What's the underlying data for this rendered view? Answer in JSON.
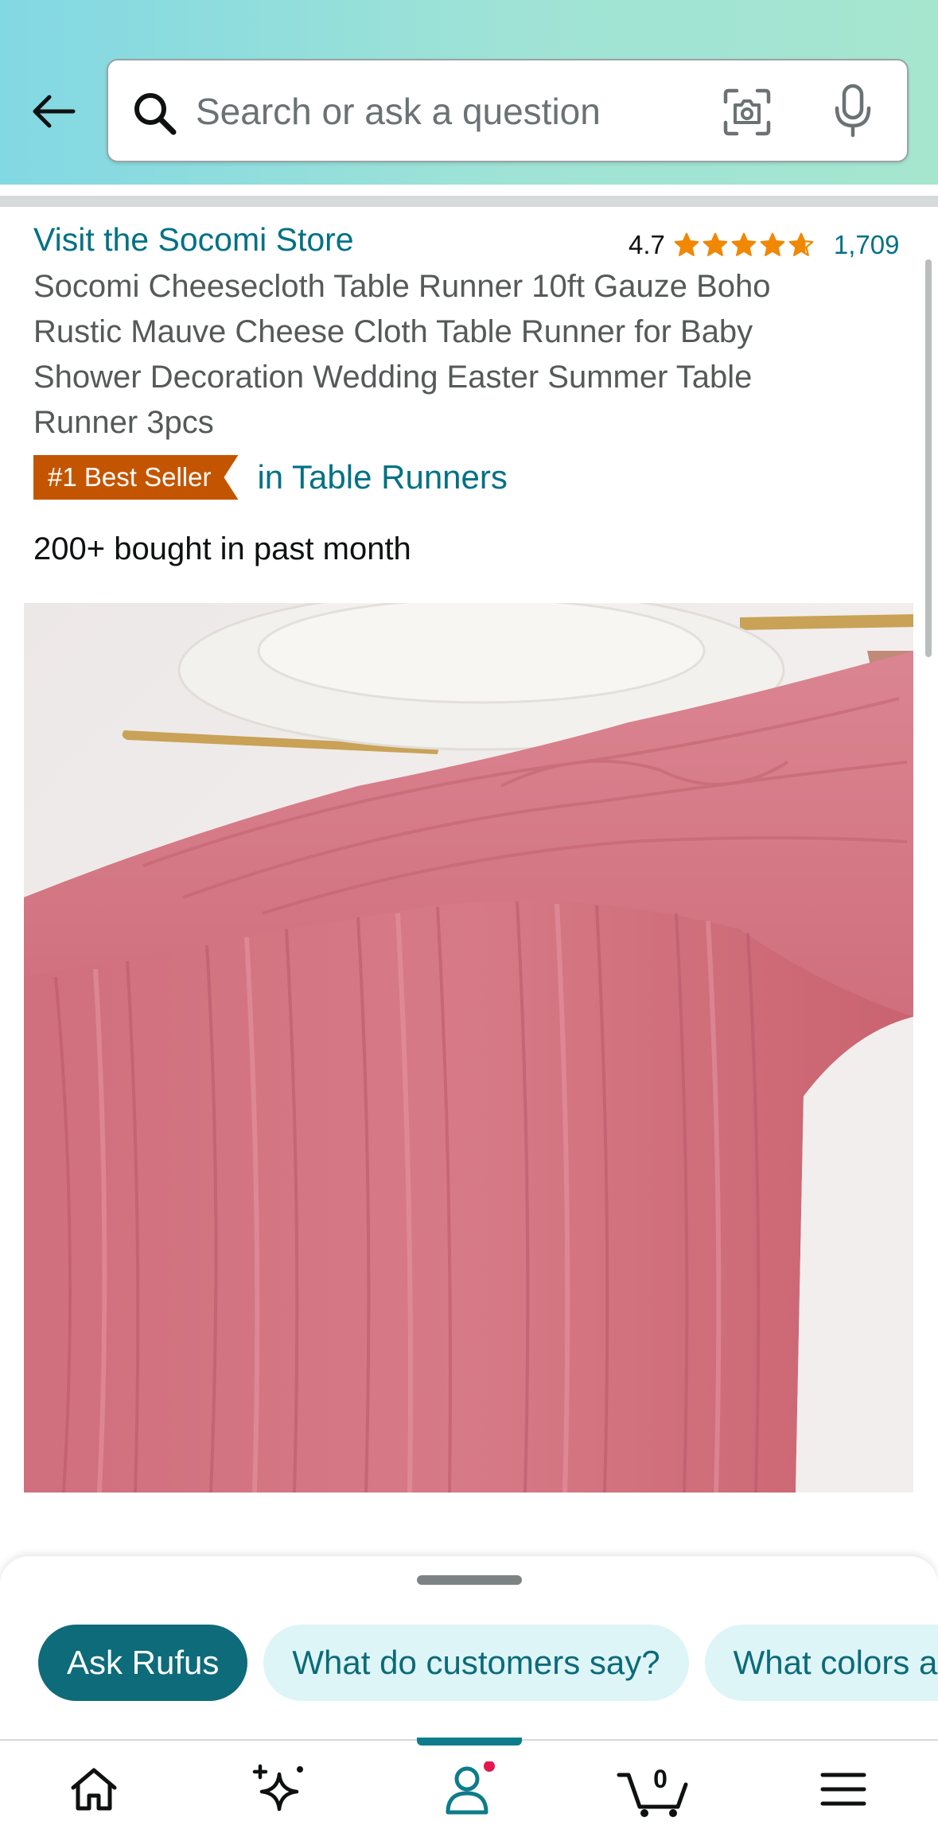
{
  "header": {
    "search_placeholder": "Search or ask a question",
    "icons": [
      "back-arrow-icon",
      "search-icon",
      "camera-icon",
      "microphone-icon"
    ]
  },
  "product": {
    "store_link": "Visit the Socomi Store",
    "rating": "4.7",
    "stars": 4.7,
    "rating_count": "1,709",
    "title": "Socomi Cheesecloth Table Runner 10ft Gauze Boho Rustic Mauve Cheese Cloth Table Runner for Baby Shower Decoration Wedding Easter Summer Table Runner 3pcs",
    "badge": "#1 Best Seller",
    "badge_category": "in Table Runners",
    "bought": "200+ bought in past month"
  },
  "rufus": {
    "chips": [
      {
        "label": "Ask Rufus",
        "primary": true
      },
      {
        "label": "What do customers say?",
        "primary": false
      },
      {
        "label": "What colors are available?",
        "primary": false
      }
    ]
  },
  "nav": {
    "items": [
      "home-icon",
      "sparkle-icon",
      "account-icon",
      "cart-icon",
      "menu-icon"
    ],
    "cart_count": "0",
    "active": "account"
  },
  "colors": {
    "link": "#007185",
    "badge": "#c45500",
    "star": "#f08804",
    "rufus_primary": "#0e6b7a",
    "fabric": "#d1707e"
  }
}
